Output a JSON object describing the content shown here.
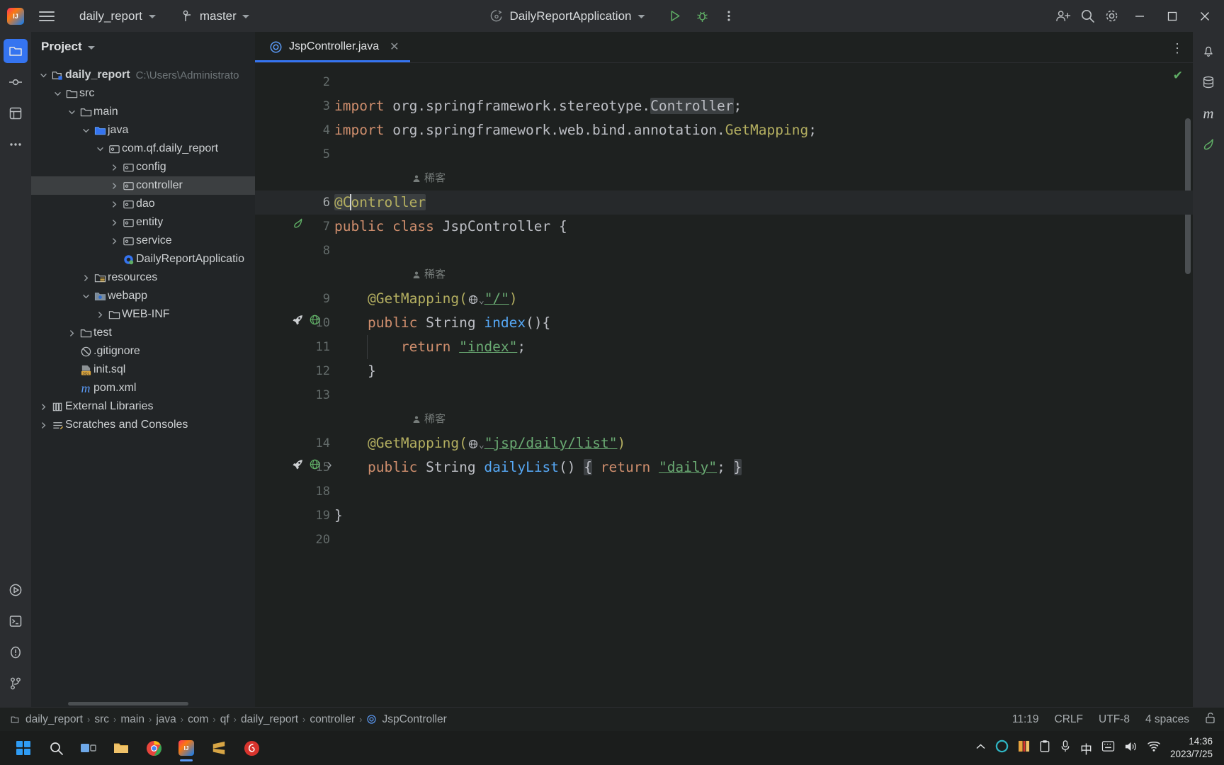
{
  "titlebar": {
    "app_logo": "intellij-idea-logo",
    "menu_icon": "hamburger-menu-icon",
    "project_name": "daily_report",
    "branch_icon": "git-branch-icon",
    "branch_name": "master",
    "run_config_icon": "spring-boot-icon",
    "run_config_name": "DailyReportApplication",
    "run_button": "run-icon",
    "debug_button": "debug-icon",
    "more_button": "more-vertical-icon",
    "code_with_me": "code-with-me-icon",
    "search_button": "search-icon",
    "settings_button": "settings-gear-icon",
    "minimize": "minimize-icon",
    "maximize": "maximize-icon",
    "close": "close-icon"
  },
  "left_rail": {
    "items": [
      {
        "name": "project-tool-window",
        "icon": "folder-icon",
        "active": true
      },
      {
        "name": "commit-tool-window",
        "icon": "commit-icon",
        "active": false
      },
      {
        "name": "structure-tool-window",
        "icon": "structure-icon",
        "active": false
      },
      {
        "name": "more-tool-windows",
        "icon": "ellipsis-icon",
        "active": false
      }
    ],
    "bottom_items": [
      {
        "name": "run-tool-window",
        "icon": "run-circle-icon"
      },
      {
        "name": "terminal-tool-window",
        "icon": "terminal-icon"
      },
      {
        "name": "problems-tool-window",
        "icon": "problems-icon"
      },
      {
        "name": "version-control-tool-window",
        "icon": "vcs-branch-icon"
      }
    ]
  },
  "right_rail": {
    "items": [
      {
        "name": "notifications-tool-window",
        "icon": "bell-icon"
      },
      {
        "name": "database-tool-window",
        "icon": "database-icon"
      },
      {
        "name": "maven-tool-window",
        "icon": "maven-m-icon"
      },
      {
        "name": "spring-tool-window",
        "icon": "spring-leaf-icon"
      }
    ]
  },
  "project_panel": {
    "title": "Project",
    "title_chevron": "chevron-down-icon",
    "tree": [
      {
        "depth": 0,
        "arrow": "expanded",
        "icon": "module-icon",
        "label": "daily_report",
        "bold": true,
        "path": "C:\\Users\\Administrato",
        "selected": false
      },
      {
        "depth": 1,
        "arrow": "expanded",
        "icon": "folder-icon",
        "label": "src",
        "bold": false,
        "path": "",
        "selected": false
      },
      {
        "depth": 2,
        "arrow": "expanded",
        "icon": "folder-icon",
        "label": "main",
        "bold": false,
        "path": "",
        "selected": false
      },
      {
        "depth": 3,
        "arrow": "expanded",
        "icon": "source-root-icon",
        "label": "java",
        "bold": false,
        "path": "",
        "selected": false
      },
      {
        "depth": 4,
        "arrow": "expanded",
        "icon": "package-icon",
        "label": "com.qf.daily_report",
        "bold": false,
        "path": "",
        "selected": false
      },
      {
        "depth": 5,
        "arrow": "collapsed",
        "icon": "package-icon",
        "label": "config",
        "bold": false,
        "path": "",
        "selected": false
      },
      {
        "depth": 5,
        "arrow": "collapsed",
        "icon": "package-icon",
        "label": "controller",
        "bold": false,
        "path": "",
        "selected": true
      },
      {
        "depth": 5,
        "arrow": "collapsed",
        "icon": "package-icon",
        "label": "dao",
        "bold": false,
        "path": "",
        "selected": false
      },
      {
        "depth": 5,
        "arrow": "collapsed",
        "icon": "package-icon",
        "label": "entity",
        "bold": false,
        "path": "",
        "selected": false
      },
      {
        "depth": 5,
        "arrow": "collapsed",
        "icon": "package-icon",
        "label": "service",
        "bold": false,
        "path": "",
        "selected": false
      },
      {
        "depth": 5,
        "arrow": "none",
        "icon": "spring-class-icon",
        "label": "DailyReportApplicatio",
        "bold": false,
        "path": "",
        "selected": false
      },
      {
        "depth": 3,
        "arrow": "collapsed",
        "icon": "resources-root-icon",
        "label": "resources",
        "bold": false,
        "path": "",
        "selected": false
      },
      {
        "depth": 3,
        "arrow": "expanded",
        "icon": "webapp-root-icon",
        "label": "webapp",
        "bold": false,
        "path": "",
        "selected": false
      },
      {
        "depth": 4,
        "arrow": "collapsed",
        "icon": "folder-icon",
        "label": "WEB-INF",
        "bold": false,
        "path": "",
        "selected": false
      },
      {
        "depth": 2,
        "arrow": "collapsed",
        "icon": "folder-icon",
        "label": "test",
        "bold": false,
        "path": "",
        "selected": false
      },
      {
        "depth": 2,
        "arrow": "none",
        "icon": "gitignore-icon",
        "label": ".gitignore",
        "bold": false,
        "path": "",
        "selected": false
      },
      {
        "depth": 2,
        "arrow": "none",
        "icon": "sql-file-icon",
        "label": "init.sql",
        "bold": false,
        "path": "",
        "selected": false
      },
      {
        "depth": 2,
        "arrow": "none",
        "icon": "maven-m-icon",
        "label": "pom.xml",
        "bold": false,
        "path": "",
        "selected": false
      },
      {
        "depth": 0,
        "arrow": "collapsed",
        "icon": "libraries-icon",
        "label": "External Libraries",
        "bold": false,
        "path": "",
        "selected": false
      },
      {
        "depth": 0,
        "arrow": "collapsed",
        "icon": "scratches-icon",
        "label": "Scratches and Consoles",
        "bold": false,
        "path": "",
        "selected": false
      }
    ]
  },
  "editor": {
    "tab": {
      "icon": "java-class-icon",
      "label": "JspController.java",
      "close": "close-icon"
    },
    "tab_options": "more-vertical-icon",
    "inspection_status": "ok-check-icon",
    "lines": [
      {
        "num": "2",
        "gutter": [],
        "author": null,
        "current": false,
        "indent_guides": []
      },
      {
        "num": "3",
        "gutter": [],
        "author": null,
        "current": false,
        "indent_guides": []
      },
      {
        "num": "4",
        "gutter": [],
        "author": null,
        "current": false,
        "indent_guides": []
      },
      {
        "num": "5",
        "gutter": [],
        "author": null,
        "current": false,
        "indent_guides": []
      },
      {
        "num": "6",
        "gutter": [],
        "author": "稀客",
        "current": true,
        "indent_guides": []
      },
      {
        "num": "7",
        "gutter": [
          "spring-bean-icon"
        ],
        "author": null,
        "current": false,
        "indent_guides": []
      },
      {
        "num": "8",
        "gutter": [],
        "author": null,
        "current": false,
        "indent_guides": []
      },
      {
        "num": "9",
        "gutter": [],
        "author": "稀客",
        "current": false,
        "indent_guides": []
      },
      {
        "num": "10",
        "gutter": [
          "run-endpoint-icon",
          "web-mapping-icon"
        ],
        "author": null,
        "current": false,
        "indent_guides": []
      },
      {
        "num": "11",
        "gutter": [],
        "author": null,
        "current": false,
        "indent_guides": []
      },
      {
        "num": "12",
        "gutter": [],
        "author": null,
        "current": false,
        "indent_guides": []
      },
      {
        "num": "13",
        "gutter": [],
        "author": null,
        "current": false,
        "indent_guides": []
      },
      {
        "num": "14",
        "gutter": [],
        "author": "稀客",
        "current": false,
        "indent_guides": []
      },
      {
        "num": "15",
        "gutter": [
          "run-endpoint-icon",
          "web-mapping-icon",
          "expand-fold-icon"
        ],
        "author": null,
        "current": false,
        "indent_guides": []
      },
      {
        "num": "18",
        "gutter": [],
        "author": null,
        "current": false,
        "indent_guides": []
      },
      {
        "num": "19",
        "gutter": [],
        "author": null,
        "current": false,
        "indent_guides": []
      },
      {
        "num": "20",
        "gutter": [],
        "author": null,
        "current": false,
        "indent_guides": []
      }
    ],
    "code": {
      "l3_import": "import",
      "l3_pkg": " org.springframework.stereotype.",
      "l3_cls": "Controller",
      "l3_semi": ";",
      "l4_import": "import",
      "l4_pkg": " org.springframework.web.bind.annotation.",
      "l4_cls": "GetMapping",
      "l4_semi": ";",
      "l6_at": "@",
      "l6_pre": "C",
      "l6_post": "ontroller",
      "l7_kw1": "public",
      "l7_kw2": "class",
      "l7_name": "JspController",
      "l7_brace": "{",
      "l9_ann": "@GetMapping(",
      "l9_str": "\"/\"",
      "l9_end": ")",
      "l10_kw": "public",
      "l10_type": "String",
      "l10_mth": "index",
      "l10_rest": "(){",
      "l11_kw": "return",
      "l11_str": "\"index\"",
      "l11_semi": ";",
      "l12_brace": "}",
      "l14_ann": "@GetMapping(",
      "l14_str": "\"jsp/daily/list\"",
      "l14_end": ")",
      "l15_kw": "public",
      "l15_type": "String",
      "l15_mth": "dailyList",
      "l15_paren": "() ",
      "l15_fold_open": "{",
      "l15_ret": " return ",
      "l15_str": "\"daily\"",
      "l15_semi": "; ",
      "l15_fold_close": "}",
      "l19_brace": "}"
    }
  },
  "statusbar": {
    "breadcrumbs": [
      {
        "label": "daily_report",
        "icon": "module-icon"
      },
      {
        "label": "src",
        "icon": null
      },
      {
        "label": "main",
        "icon": null
      },
      {
        "label": "java",
        "icon": null
      },
      {
        "label": "com",
        "icon": null
      },
      {
        "label": "qf",
        "icon": null
      },
      {
        "label": "daily_report",
        "icon": null
      },
      {
        "label": "controller",
        "icon": null
      },
      {
        "label": "JspController",
        "icon": "java-class-icon"
      }
    ],
    "caret_position": "11:19",
    "line_separator": "CRLF",
    "encoding": "UTF-8",
    "indent": "4 spaces",
    "lock_icon": "unlocked-icon"
  },
  "taskbar": {
    "start": "windows-start-icon",
    "items": [
      {
        "name": "taskbar-search",
        "icon": "search-icon",
        "running": false
      },
      {
        "name": "taskbar-task-view",
        "icon": "task-view-icon",
        "running": false
      },
      {
        "name": "taskbar-file-explorer",
        "icon": "file-explorer-icon",
        "running": false
      },
      {
        "name": "taskbar-chrome",
        "icon": "chrome-icon",
        "running": false
      },
      {
        "name": "taskbar-intellij-idea",
        "icon": "intellij-idea-icon",
        "running": true
      },
      {
        "name": "taskbar-sublime-text",
        "icon": "sublime-text-icon",
        "running": false
      },
      {
        "name": "taskbar-netease-music",
        "icon": "netease-music-icon",
        "running": false
      }
    ],
    "tray": [
      {
        "name": "tray-show-hidden",
        "icon": "chevron-up-icon"
      },
      {
        "name": "tray-app",
        "icon": "circle-teal-icon"
      },
      {
        "name": "tray-sogou",
        "icon": "sogou-icon"
      },
      {
        "name": "tray-clipboard",
        "icon": "clipboard-icon"
      },
      {
        "name": "tray-microphone",
        "icon": "microphone-icon"
      },
      {
        "name": "tray-ime-chinese",
        "icon": "ime-chinese-icon"
      },
      {
        "name": "tray-ime-panel",
        "icon": "ime-panel-icon"
      },
      {
        "name": "tray-volume",
        "icon": "volume-icon"
      },
      {
        "name": "tray-network",
        "icon": "network-icon"
      }
    ],
    "clock_time": "14:36",
    "clock_date": "2023/7/25"
  }
}
